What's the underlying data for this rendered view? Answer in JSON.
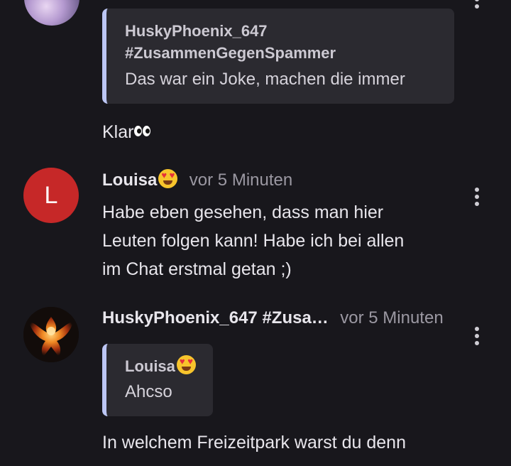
{
  "quoted_message_1": {
    "author_line1": "HuskyPhoenix_647",
    "author_line2": "#ZusammenGegenSpammer",
    "text": "Das war ein Joke, machen die immer"
  },
  "reply_1": {
    "text": "Klar",
    "emoji": "eyes-emoji"
  },
  "message_louisa": {
    "avatar_letter": "L",
    "avatar_color": "#c62828",
    "author": "Louisa",
    "author_emoji": "heart-eyes-emoji",
    "time": "vor 5 Minuten",
    "lines": [
      "Habe eben gesehen, dass man hier",
      "Leuten folgen kann! Habe ich bei allen",
      "im Chat erstmal getan ;)"
    ]
  },
  "message_husky": {
    "author": "HuskyPhoenix_647 #Zusa…",
    "time": "vor 5 Minuten",
    "quote": {
      "author": "Louisa",
      "author_emoji": "heart-eyes-emoji",
      "text": "Ahcso"
    },
    "text": "In welchem Freizeitpark warst du denn"
  },
  "colors": {
    "background": "#18171c",
    "quote_background": "#2b2a30",
    "quote_accent": "#bcc6f4",
    "timestamp": "#9b98a2"
  }
}
